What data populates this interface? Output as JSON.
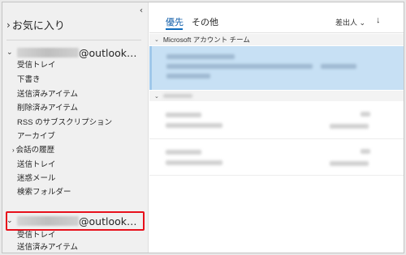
{
  "sidebar": {
    "collapse_glyph": "‹",
    "favorites": {
      "label": "お気に入り",
      "chevron": "›"
    },
    "account1": {
      "chevron": "⌄",
      "address": "@outlook…",
      "folders": [
        "受信トレイ",
        "下書き",
        "送信済みアイテム",
        "削除済みアイテム",
        "RSS のサブスクリプション",
        "アーカイブ",
        "会話の履歴",
        "送信トレイ",
        "迷惑メール",
        "検索フォルダー"
      ]
    },
    "account2": {
      "chevron": "⌄",
      "address": "@outlook…",
      "folders": [
        "受信トレイ",
        "送信済みアイテム"
      ]
    }
  },
  "main": {
    "tabs": [
      {
        "label": "優先",
        "active": true
      },
      {
        "label": "その他",
        "active": false
      }
    ],
    "sort": {
      "label": "差出人",
      "chevron": "⌄",
      "arrow": "↓"
    },
    "group_header": {
      "chevron": "⌄",
      "label": "Microsoft アカウント チーム"
    },
    "accent_color": "#0f6cbd",
    "selected_color": "#c7e0f4",
    "highlight_color": "#e8101b"
  }
}
